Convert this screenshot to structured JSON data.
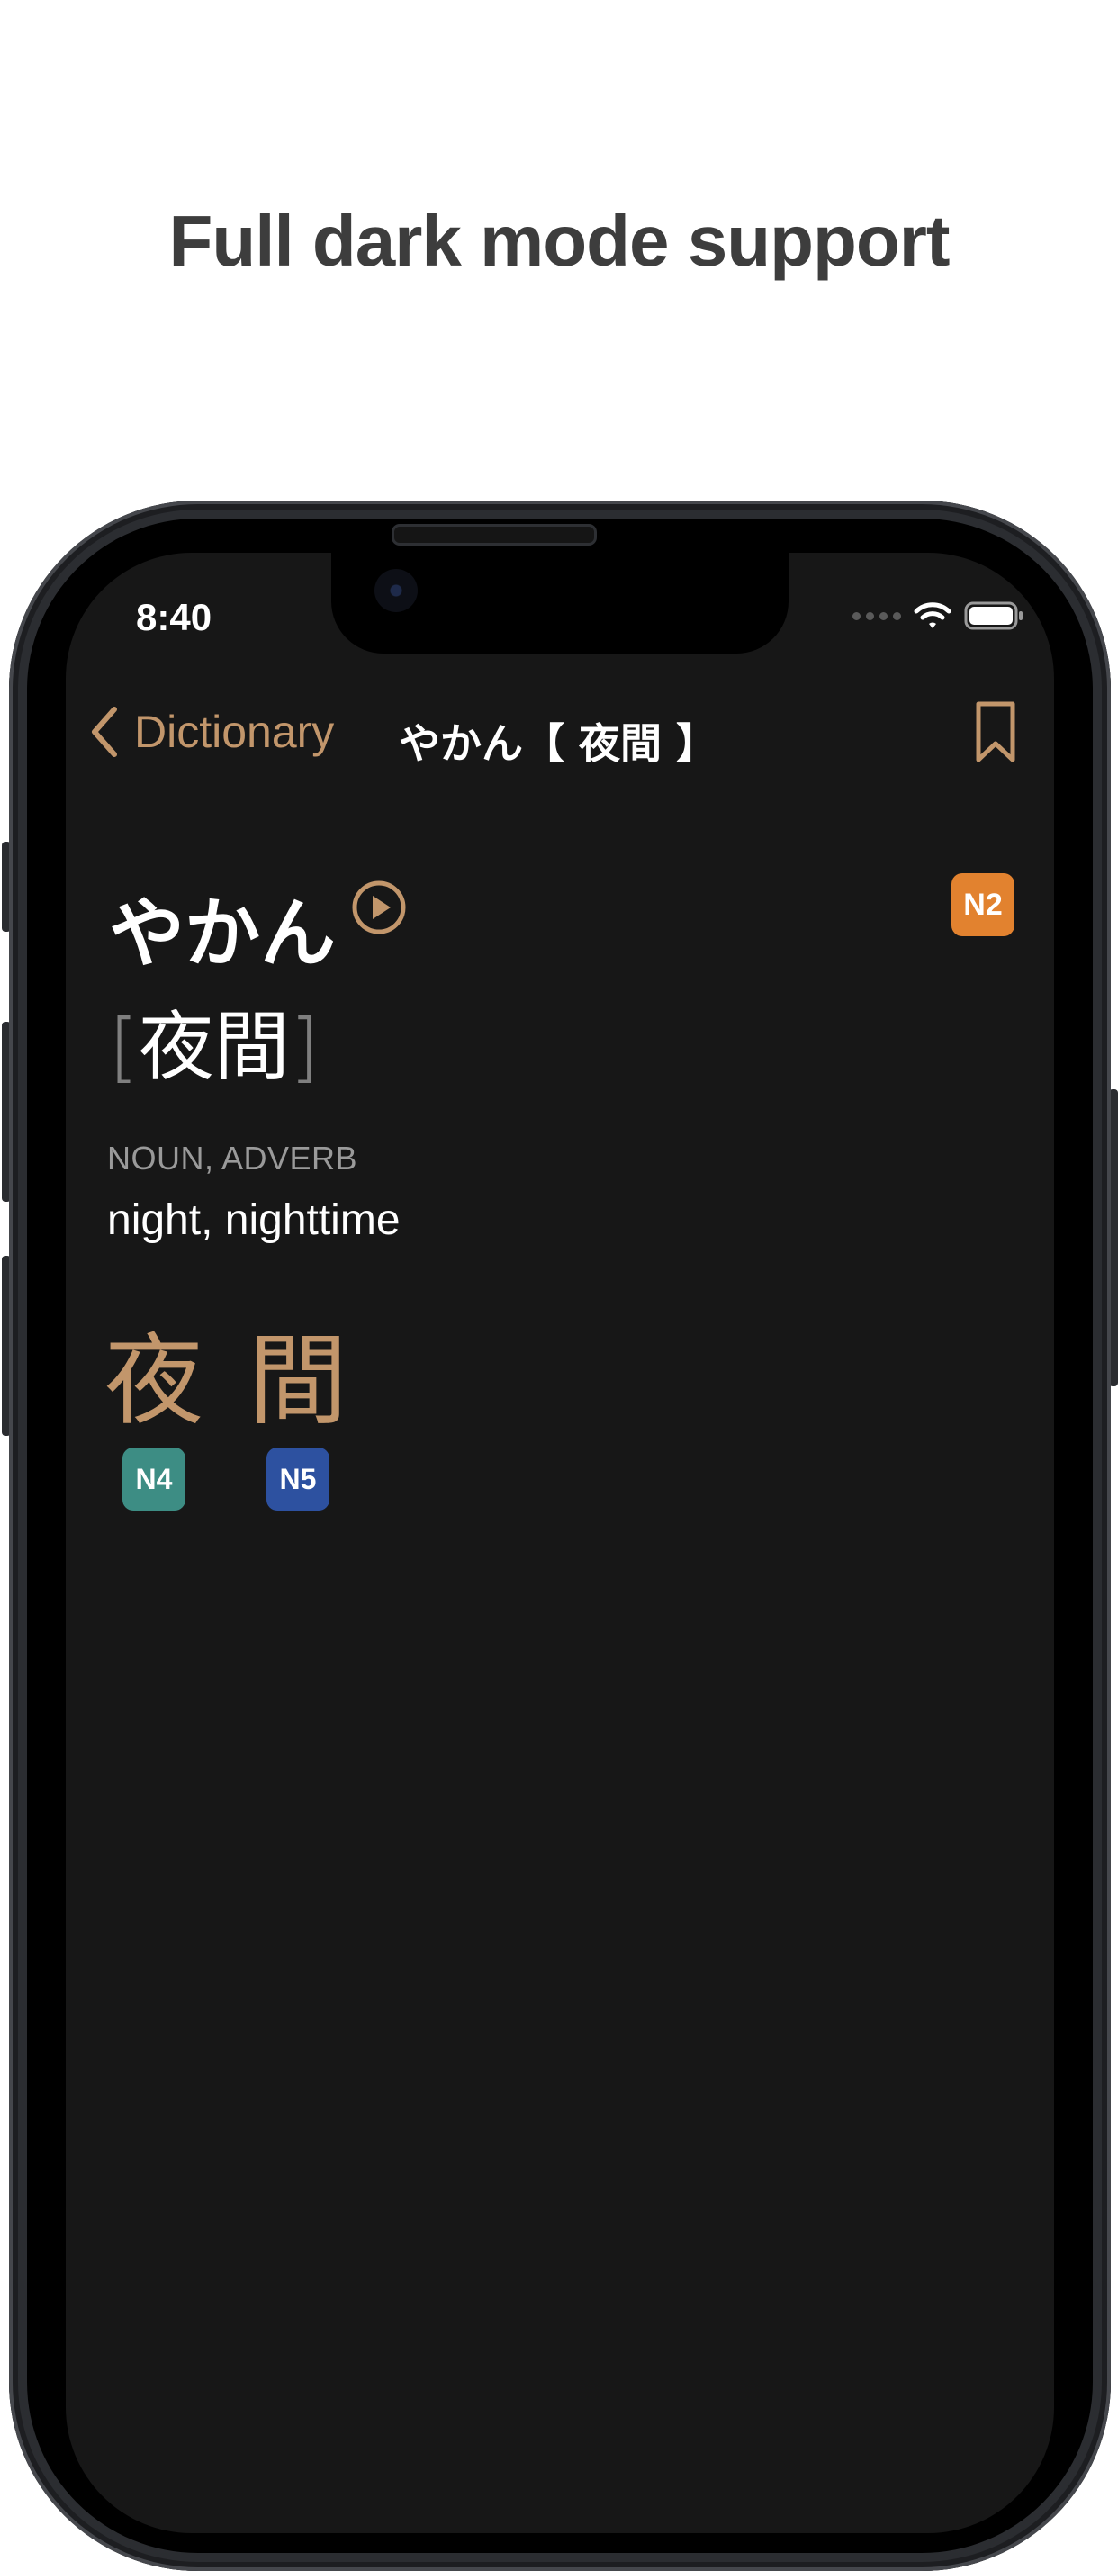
{
  "headline": "Full dark mode support",
  "status_bar": {
    "time": "8:40",
    "icons": [
      "cellular-dots-icon",
      "wifi-icon",
      "battery-icon"
    ]
  },
  "nav": {
    "back_label": "Dictionary",
    "title": "やかん【 夜間 】",
    "bookmark_icon": "bookmark-icon"
  },
  "entry": {
    "reading": "やかん",
    "play_icon": "play-audio-icon",
    "jlpt_level": "N2",
    "kanji_form": "夜間",
    "bracket_open": "[",
    "bracket_close": "]",
    "part_of_speech": "NOUN, ADVERB",
    "meaning": "night, nighttime"
  },
  "kanji": [
    {
      "char": "夜",
      "level": "N4",
      "badge_color": "#3d8d84"
    },
    {
      "char": "間",
      "level": "N5",
      "badge_color": "#2d51a0"
    }
  ],
  "colors": {
    "accent": "#c2966b",
    "background": "#171717",
    "n2": "#e2822f"
  }
}
